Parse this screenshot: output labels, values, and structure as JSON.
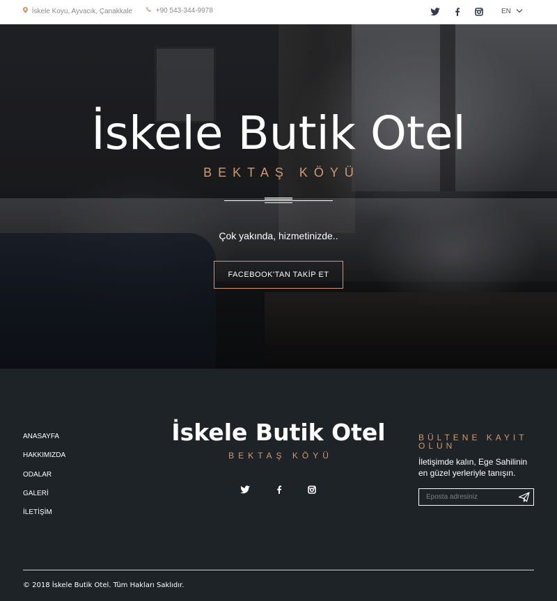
{
  "topbar": {
    "address": "İskele Koyu, Ayvacık, Çanakkale",
    "phone": "+90 543-344-9978",
    "language": "EN",
    "social": [
      "twitter-icon",
      "facebook-icon",
      "instagram-icon"
    ]
  },
  "hero": {
    "title": "İskele Butik Otel",
    "subtitle": "BEKTAŞ KÖYÜ",
    "tagline": "Çok yakında, hizmetinizde..",
    "button_label": "FACEBOOK'TAN TAKİP ET"
  },
  "footer": {
    "nav": [
      "ANASAYFA",
      "HAKKIMIZDA",
      "ODALAR",
      "GALERİ",
      "İLETİŞİM"
    ],
    "title": "İskele Butik Otel",
    "subtitle": "BEKTAŞ KÖYÜ",
    "newsletter": {
      "heading": "BÜLTENE KAYIT OLUN",
      "text": "İletişimde kalın, Ege Sahilinin en güzel yerleriyle tanışın.",
      "placeholder": "Eposta adresiniz"
    },
    "copyright": "© 2018 İskele Butik Otel. Tüm Hakları Saklıdır."
  },
  "colors": {
    "accent": "#d29a6e",
    "footer_bg": "#1e2327",
    "topbar_bg": "#ffffff"
  }
}
